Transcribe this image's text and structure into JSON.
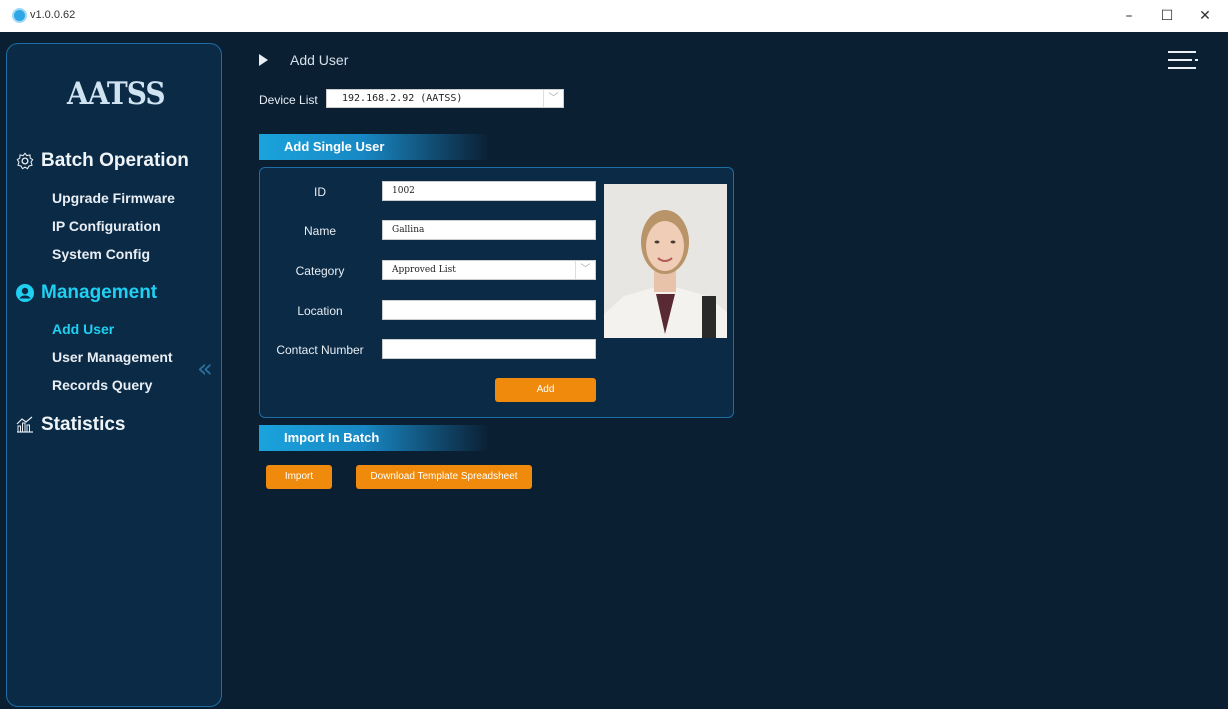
{
  "window": {
    "version": "v1.0.0.62"
  },
  "sidebar": {
    "logo": "AATSS",
    "sections": [
      {
        "label": "Batch Operation",
        "icon": "gear-icon",
        "items": [
          "Upgrade Firmware",
          "IP Configuration",
          "System Config"
        ]
      },
      {
        "label": "Management",
        "icon": "user-icon",
        "items": [
          "Add User",
          "User Management",
          "Records Query"
        ]
      },
      {
        "label": "Statistics",
        "icon": "chart-icon",
        "items": []
      }
    ],
    "active_item": "Add User"
  },
  "header": {
    "breadcrumb": "Add User"
  },
  "device": {
    "label": "Device List",
    "selected": "192.168.2.92 (AATSS)"
  },
  "single_user": {
    "title": "Add Single User",
    "fields": {
      "id": {
        "label": "ID",
        "value": "1002"
      },
      "name": {
        "label": "Name",
        "value": "Gallina"
      },
      "category": {
        "label": "Category",
        "value": "Approved List"
      },
      "location": {
        "label": "Location",
        "value": ""
      },
      "contact": {
        "label": "Contact Number",
        "value": ""
      }
    },
    "add_button": "Add"
  },
  "batch": {
    "title": "Import In Batch",
    "import_button": "Import",
    "template_button": "Download Template Spreadsheet"
  },
  "colors": {
    "background": "#0b1f33",
    "accent": "#1fd0f2",
    "button": "#f08a0c",
    "banner": "#1aa3dc"
  }
}
